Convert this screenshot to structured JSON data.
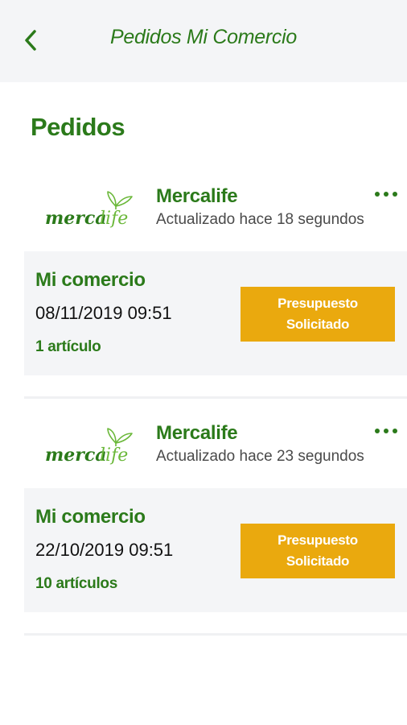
{
  "header": {
    "title": "Pedidos Mi Comercio",
    "back_icon": "chevron-left-icon"
  },
  "section_title": "Pedidos",
  "colors": {
    "brand_green": "#2b7a1a",
    "status_orange": "#eaa90e",
    "panel_gray": "#f4f5f7"
  },
  "orders": [
    {
      "store_name": "Mercalife",
      "store_logo_text_a": "merca",
      "store_logo_text_b": "life",
      "updated": "Actualizado hace 18 segundos",
      "commerce": "Mi comercio",
      "date": "08/11/2019 09:51",
      "items": "1 artículo",
      "status": "Presupuesto Solicitado"
    },
    {
      "store_name": "Mercalife",
      "store_logo_text_a": "merca",
      "store_logo_text_b": "life",
      "updated": "Actualizado hace 23 segundos",
      "commerce": "Mi comercio",
      "date": "22/10/2019 09:51",
      "items": "10 artículos",
      "status": "Presupuesto Solicitado"
    }
  ]
}
